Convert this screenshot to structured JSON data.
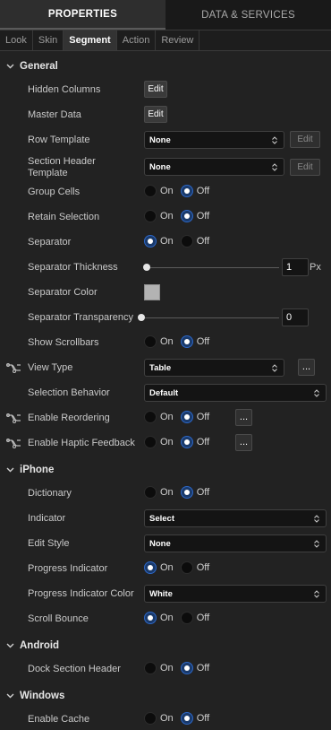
{
  "tabs": {
    "properties": "PROPERTIES",
    "data_services": "DATA & SERVICES"
  },
  "subtabs": [
    "Look",
    "Skin",
    "Segment",
    "Action",
    "Review"
  ],
  "sections": {
    "general": "General",
    "iphone": "iPhone",
    "android": "Android",
    "windows": "Windows"
  },
  "radio": {
    "on": "On",
    "off": "Off"
  },
  "edit_label": "Edit",
  "ellipsis_label": "...",
  "general": {
    "hidden_columns": "Hidden Columns",
    "master_data": "Master Data",
    "row_template": {
      "label": "Row Template",
      "value": "None"
    },
    "section_header_template": {
      "label_line1": "Section Header",
      "label_line2": "Template",
      "value": "None"
    },
    "group_cells": {
      "label": "Group Cells",
      "selected": "Off"
    },
    "retain_selection": {
      "label": "Retain Selection",
      "selected": "Off"
    },
    "separator": {
      "label": "Separator",
      "selected": "On"
    },
    "separator_thickness": {
      "label": "Separator Thickness",
      "value": "1",
      "unit": "Px",
      "slider_fraction": 0.0
    },
    "separator_color": {
      "label": "Separator Color",
      "color": "#b3b3b3"
    },
    "separator_transparency": {
      "label": "Separator Transparency",
      "value": "0",
      "slider_fraction": 0.0
    },
    "show_scrollbars": {
      "label": "Show Scrollbars",
      "selected": "Off"
    },
    "view_type": {
      "label": "View Type",
      "value": "Table"
    },
    "selection_behavior": {
      "label": "Selection Behavior",
      "value": "Default"
    },
    "enable_reordering": {
      "label": "Enable Reordering",
      "selected": "Off"
    },
    "enable_haptic_feedback": {
      "label": "Enable Haptic Feedback",
      "selected": "Off"
    }
  },
  "iphone": {
    "dictionary": {
      "label": "Dictionary",
      "selected": "Off"
    },
    "indicator": {
      "label": "Indicator",
      "value": "Select"
    },
    "edit_style": {
      "label": "Edit Style",
      "value": "None"
    },
    "progress_indicator": {
      "label": "Progress Indicator",
      "selected": "On"
    },
    "progress_indicator_color": {
      "label": "Progress Indicator Color",
      "value": "White"
    },
    "scroll_bounce": {
      "label": "Scroll Bounce",
      "selected": "On"
    }
  },
  "android": {
    "dock_section_header": {
      "label": "Dock Section Header",
      "selected": "Off"
    }
  },
  "windows": {
    "enable_cache": {
      "label": "Enable Cache",
      "selected": "Off"
    }
  },
  "colors": {
    "accent": "#2c67c7",
    "panel": "#222222"
  }
}
